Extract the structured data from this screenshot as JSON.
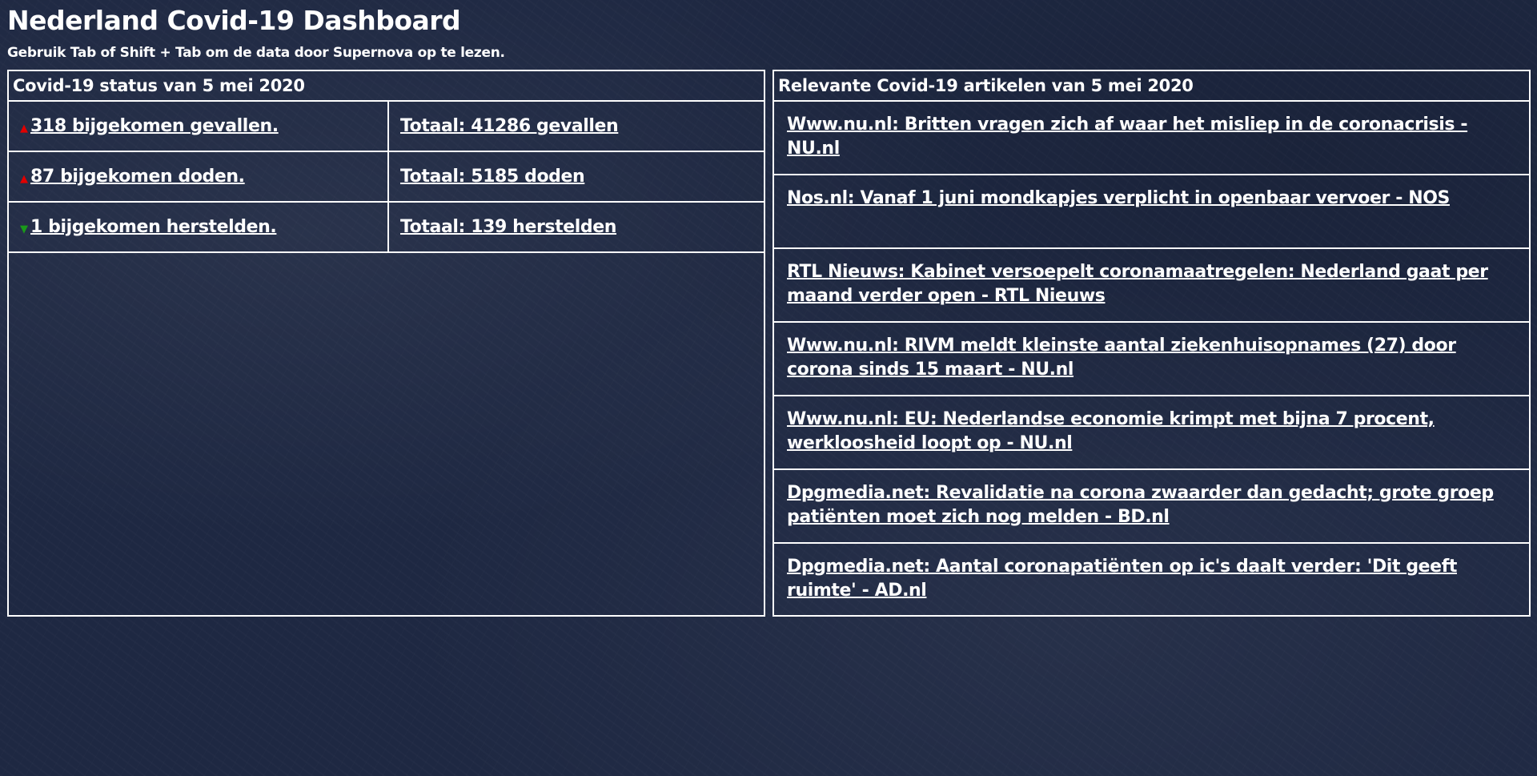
{
  "header": {
    "title": "Nederland Covid-19 Dashboard",
    "subtitle": "Gebruik Tab of Shift + Tab om de data door Supernova op te lezen."
  },
  "status": {
    "heading": "Covid-19 status van 5 mei 2020",
    "rows": [
      {
        "trend": "up",
        "new": "318 bijgekomen gevallen.",
        "total": "Totaal: 41286 gevallen"
      },
      {
        "trend": "up",
        "new": "87 bijgekomen doden.",
        "total": "Totaal: 5185 doden"
      },
      {
        "trend": "down",
        "new": "1 bijgekomen herstelden.",
        "total": "Totaal: 139 herstelden"
      }
    ],
    "colors": {
      "up": "#e00000",
      "down": "#1a9a1a"
    }
  },
  "articles": {
    "heading": "Relevante Covid-19 artikelen van 5 mei 2020",
    "items": [
      "Www.nu.nl: Britten vragen zich af waar het misliep in de coronacrisis - NU.nl",
      "Nos.nl: Vanaf 1 juni mondkapjes verplicht in openbaar vervoer - NOS",
      "RTL Nieuws: Kabinet versoepelt coronamaatregelen: Nederland gaat per maand verder open - RTL Nieuws",
      "Www.nu.nl: RIVM meldt kleinste aantal ziekenhuisopnames (27) door corona sinds 15 maart - NU.nl",
      "Www.nu.nl: EU: Nederlandse economie krimpt met bijna 7 procent, werkloosheid loopt op - NU.nl",
      "Dpgmedia.net: Revalidatie na corona zwaarder dan gedacht; grote groep patiënten moet zich nog melden - BD.nl",
      "Dpgmedia.net: Aantal coronapatiënten op ic's daalt verder: 'Dit geeft ruimte' - AD.nl"
    ]
  }
}
